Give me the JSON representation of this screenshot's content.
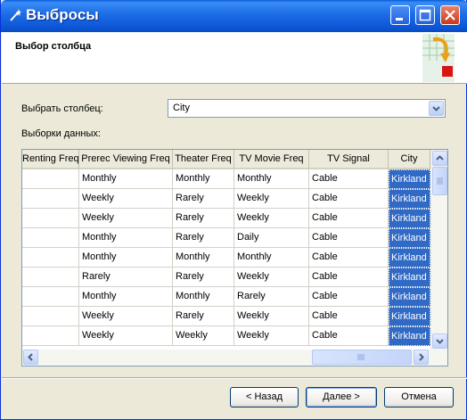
{
  "window": {
    "title": "Выбросы"
  },
  "header": {
    "title": "Выбор столбца"
  },
  "column_select": {
    "label": "Выбрать столбец:",
    "value": "City"
  },
  "samples_label": "Выборки данных:",
  "grid": {
    "columns": [
      "Renting Freq",
      "Prerec Viewing Freq",
      "Theater Freq",
      "TV Movie Freq",
      "TV Signal",
      "City"
    ],
    "rows": [
      [
        "",
        "Monthly",
        "Monthly",
        "Monthly",
        "Cable",
        "Kirkland"
      ],
      [
        "",
        "Weekly",
        "Rarely",
        "Weekly",
        "Cable",
        "Kirkland"
      ],
      [
        "",
        "Weekly",
        "Rarely",
        "Weekly",
        "Cable",
        "Kirkland"
      ],
      [
        "",
        "Monthly",
        "Rarely",
        "Daily",
        "Cable",
        "Kirkland"
      ],
      [
        "",
        "Monthly",
        "Monthly",
        "Monthly",
        "Cable",
        "Kirkland"
      ],
      [
        "",
        "Rarely",
        "Rarely",
        "Weekly",
        "Cable",
        "Kirkland"
      ],
      [
        "",
        "Monthly",
        "Monthly",
        "Rarely",
        "Cable",
        "Kirkland"
      ],
      [
        "",
        "Weekly",
        "Rarely",
        "Weekly",
        "Cable",
        "Kirkland"
      ],
      [
        "",
        "Weekly",
        "Weekly",
        "Weekly",
        "Cable",
        "Kirkland"
      ]
    ]
  },
  "buttons": {
    "back": "< Назад",
    "next": "Далее >",
    "cancel": "Отмена"
  }
}
